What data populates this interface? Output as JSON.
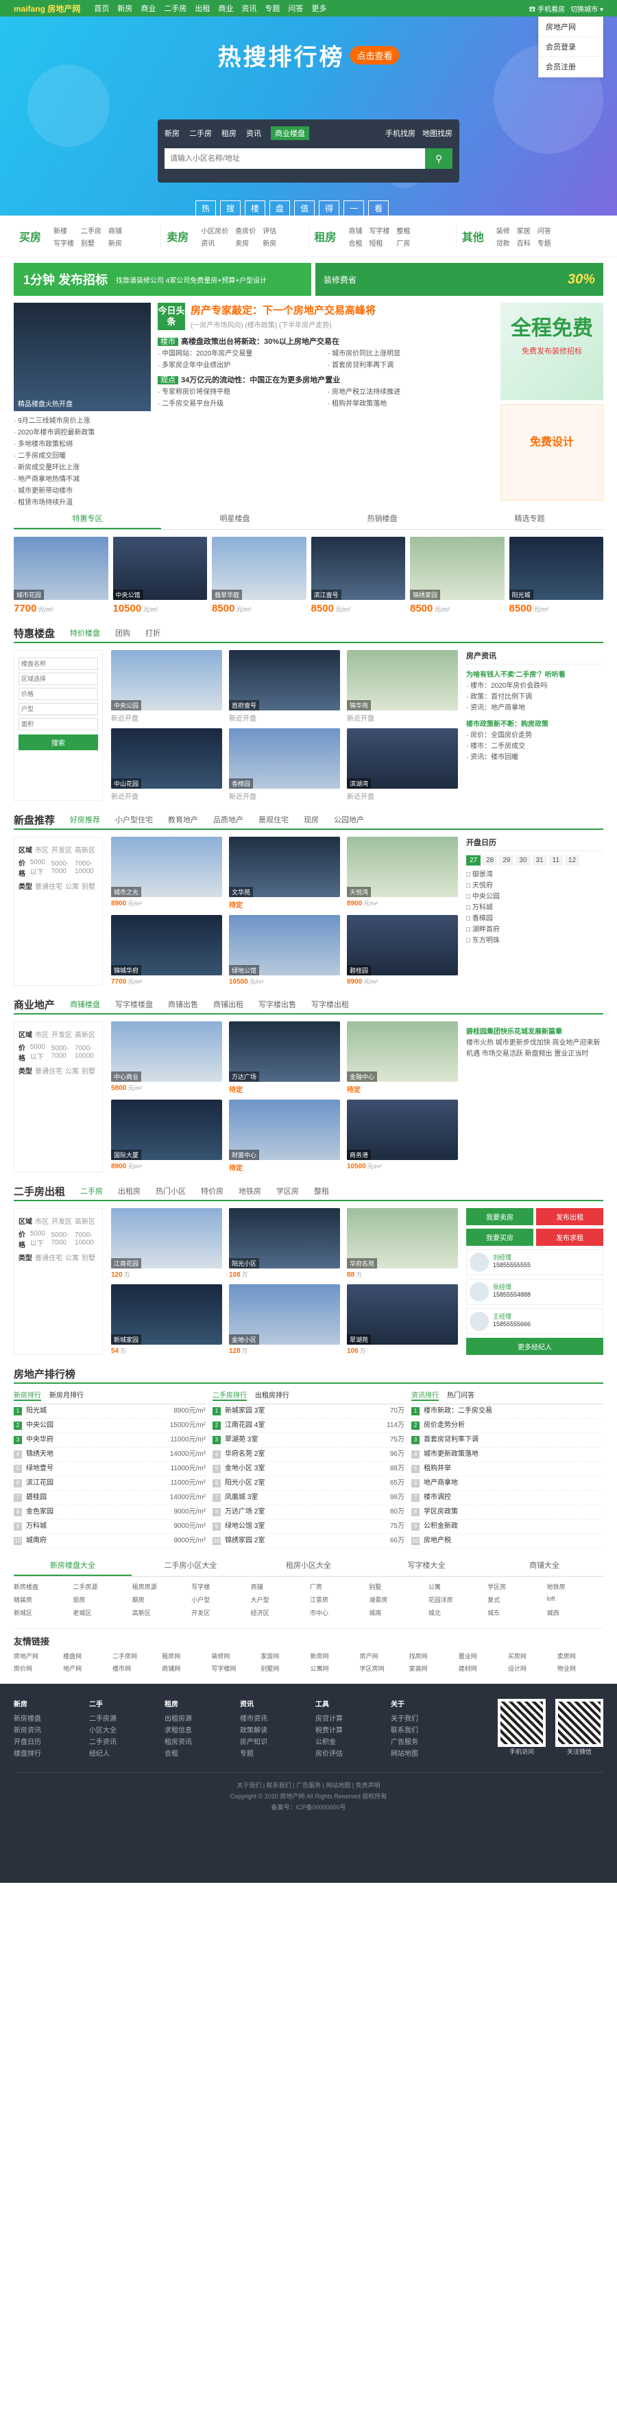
{
  "topbar": {
    "logo": "maifang 房地产网",
    "nav": [
      "首页",
      "新房",
      "商业",
      "二手房",
      "出租",
      "商业",
      "资讯",
      "专题",
      "问答",
      "更多"
    ],
    "phone": "☎ 手机看房",
    "city_switch": "切换城市 ▾",
    "dropdown": [
      "房地产网",
      "会员登录",
      "会员注册"
    ]
  },
  "banner": {
    "title": "热搜排行榜",
    "cta": "点击查看",
    "search_tabs": [
      "新房",
      "二手房",
      "租房",
      "资讯",
      "商业楼盘"
    ],
    "active_tab": "商业楼盘",
    "extra_links": [
      "手机找房",
      "地图找房"
    ],
    "search_placeholder": "请输入小区名称/地址",
    "slogan": [
      "热",
      "搜",
      "楼",
      "盘",
      "值",
      "得",
      "一",
      "看"
    ]
  },
  "quick": [
    {
      "title": "买房",
      "links": [
        "新楼",
        "二手房",
        "商铺",
        "写字楼",
        "别墅",
        "新房"
      ]
    },
    {
      "title": "卖房",
      "links": [
        "小区房价",
        "查房价",
        "评估",
        "资讯",
        "卖房",
        "新房"
      ]
    },
    {
      "title": "租房",
      "links": [
        "商铺",
        "写字楼",
        "整租",
        "合租",
        "短租",
        "厂房"
      ]
    },
    {
      "title": "其他",
      "links": [
        "装修",
        "家居",
        "问答",
        "贷款",
        "百科",
        "专题"
      ]
    }
  ],
  "ad": {
    "left_big": "1分钟 发布招标",
    "left_small": "找靠谱装修公司 4家公司免费量房+预算+户型设计",
    "right_text": "装修费省",
    "right_pct": "30%"
  },
  "headline": {
    "img_caption": "精品楼盘火热开盘",
    "left_list": [
      "9月二三线城市房价上涨",
      "2020年楼市调控最新政策",
      "多地楼市政策松绑",
      "二手房成交回暖",
      "新房成交量环比上涨",
      "地产商拿地热情不减",
      "城市更新带动楼市",
      "租赁市场持续升温"
    ],
    "today_tag": "今日头条",
    "today_title": "房产专家敲定：下一个房地产交易高峰将",
    "today_sub": "(一房产市场风向)  (楼市政策)  (下半年房产走势)",
    "news": [
      {
        "k": "楼市",
        "t": "高楼盘政策出台将新政：30%以上房地产交易在",
        "rows": [
          "中国网站：2020年房产交易量",
          "城市房价同比上涨明显",
          "多家房企年中业绩出炉",
          "首套房贷利率再下调"
        ]
      },
      {
        "k": "观点",
        "t": "34万亿元的流动性：中国正在为更多房地产置业",
        "rows": [
          "专家称房价将保持平稳",
          "房地产税立法持续推进",
          "二手房交易平台升级",
          "租购并举政策落地"
        ]
      }
    ],
    "free_big": "全程免费",
    "free_sub": "免费发布装修招标",
    "design": "免费设计"
  },
  "hot": {
    "tabs": [
      "特惠专区",
      "明星楼盘",
      "热销楼盘",
      "精选专题"
    ],
    "cards": [
      {
        "name": "城市花园",
        "price": "7700",
        "unit": "元/m²"
      },
      {
        "name": "中央公馆",
        "price": "10500",
        "unit": "元/m²"
      },
      {
        "name": "翡翠华庭",
        "price": "8500",
        "unit": "元/m²"
      },
      {
        "name": "滨江壹号",
        "price": "8500",
        "unit": "元/m²"
      },
      {
        "name": "锦绣家园",
        "price": "8500",
        "unit": "元/m²"
      },
      {
        "name": "阳光城",
        "price": "8500",
        "unit": "元/m²"
      }
    ]
  },
  "special": {
    "title": "特惠楼盘",
    "tabs": [
      "特价楼盘",
      "团购",
      "打折"
    ],
    "filter": [
      "楼盘名称",
      "区域选择",
      "价格",
      "户型",
      "面积"
    ],
    "filter_btn": "搜索",
    "items": [
      {
        "name": "中央公园",
        "tag": "新近开盘"
      },
      {
        "name": "首府壹号",
        "tag": "新近开盘"
      },
      {
        "name": "锦华苑",
        "tag": "新近开盘"
      },
      {
        "name": "中山花园",
        "tag": "新近开盘"
      },
      {
        "name": "香樟园",
        "tag": "新近开盘"
      },
      {
        "name": "滨湖湾",
        "tag": "新近开盘"
      }
    ],
    "side_title": "房产资讯",
    "side_hot": [
      "为啥有钱人不卖'二手房'？听听看",
      "楼市政策新不断：购房政策"
    ],
    "side_list": [
      "楼市：2020年房价会跌吗",
      "政策：首付比例下调",
      "资讯：地产商拿地",
      "房价：全国房价走势",
      "楼市：二手房成交",
      "资讯：楼市回暖"
    ]
  },
  "newhouse": {
    "title": "新盘推荐",
    "tabs": [
      "好房推荐",
      "小户型住宅",
      "教育地产",
      "品质地产",
      "景观住宅",
      "现房",
      "公园地产"
    ],
    "filters": [
      [
        "区域",
        "市区",
        "开发区",
        "高新区"
      ],
      [
        "价格",
        "5000以下",
        "5000-7000",
        "7000-10000"
      ],
      [
        "类型",
        "普通住宅",
        "公寓",
        "别墅"
      ]
    ],
    "items": [
      {
        "name": "城市之光",
        "price": "8900",
        "unit": "元/m²"
      },
      {
        "name": "文华苑",
        "price": "待定",
        "unit": ""
      },
      {
        "name": "天悦湾",
        "price": "8900",
        "unit": "元/m²"
      },
      {
        "name": "锦城华府",
        "price": "7700",
        "unit": "元/m²"
      },
      {
        "name": "绿地公馆",
        "price": "10500",
        "unit": "元/m²"
      },
      {
        "name": "碧桂园",
        "price": "8900",
        "unit": "元/m²"
      }
    ],
    "calendar_title": "开盘日历",
    "calendar_days": [
      "27",
      "28",
      "29",
      "30",
      "31",
      "11",
      "12"
    ],
    "calendar_list": [
      "御景湾",
      "天悦府",
      "中央公园",
      "万科城",
      "香樟园",
      "湖畔首府",
      "东方明珠"
    ]
  },
  "commercial": {
    "title": "商业地产",
    "tabs": [
      "商铺楼盘",
      "写字楼楼盘",
      "商铺出售",
      "商铺出租",
      "写字楼出售",
      "写字楼出租"
    ],
    "items": [
      {
        "name": "中心商业",
        "price": "5800",
        "unit": "元/m²"
      },
      {
        "name": "万达广场",
        "price": "待定",
        "unit": ""
      },
      {
        "name": "金融中心",
        "price": "待定",
        "unit": ""
      },
      {
        "name": "国际大厦",
        "price": "8900",
        "unit": "元/m²"
      },
      {
        "name": "财富中心",
        "price": "待定",
        "unit": ""
      },
      {
        "name": "商务港",
        "price": "10500",
        "unit": "元/m²"
      }
    ],
    "side_title": "碧桂园集团快乐花城发展新篇章",
    "side_text": "楼市火热 城市更新步伐加快 商业地产迎来新机遇 市场交易活跃 新盘频出 置业正当时"
  },
  "resale": {
    "title": "二手房出租",
    "tabs": [
      "二手房",
      "出租房",
      "热门小区",
      "特价房",
      "地铁房",
      "学区房",
      "整租"
    ],
    "items": [
      {
        "name": "江南花园",
        "price": "120",
        "unit": "万"
      },
      {
        "name": "阳光小区",
        "price": "108",
        "unit": "万"
      },
      {
        "name": "华府名苑",
        "price": "88",
        "unit": "万"
      },
      {
        "name": "新城家园",
        "price": "54",
        "unit": "万"
      },
      {
        "name": "金地小区",
        "price": "128",
        "unit": "万"
      },
      {
        "name": "翠湖苑",
        "price": "106",
        "unit": "万"
      }
    ],
    "side_btns": [
      "我要卖房",
      "发布出租",
      "我要买房",
      "发布求租"
    ],
    "agents": [
      {
        "name": "刘经理",
        "phone": "15855555555"
      },
      {
        "name": "张经理",
        "phone": "15855554888"
      },
      {
        "name": "王经理",
        "phone": "15855555666"
      }
    ],
    "agent_btn": "更多经纪人"
  },
  "rank": {
    "title": "房地产排行榜",
    "cols": [
      {
        "tabs": [
          "新房排行",
          "新房月排行"
        ],
        "items": [
          [
            "阳光城",
            "8900元/m²"
          ],
          [
            "中央公园",
            "15000元/m²"
          ],
          [
            "中央华府",
            "11000元/m²"
          ],
          [
            "锦绣天地",
            "14000元/m²"
          ],
          [
            "绿地壹号",
            "11000元/m²"
          ],
          [
            "滨江花园",
            "11000元/m²"
          ],
          [
            "碧桂园",
            "14000元/m²"
          ],
          [
            "金色家园",
            "9000元/m²"
          ],
          [
            "万科城",
            "9000元/m²"
          ],
          [
            "城南府",
            "9000元/m²"
          ]
        ]
      },
      {
        "tabs": [
          "二手房排行",
          "出租房排行"
        ],
        "items": [
          [
            "新城家园 3室",
            "70万"
          ],
          [
            "江南花园 4室",
            "114万"
          ],
          [
            "翠湖苑 3室",
            "75万"
          ],
          [
            "华府名苑 2室",
            "96万"
          ],
          [
            "金地小区 3室",
            "88万"
          ],
          [
            "阳光小区 2室",
            "65万"
          ],
          [
            "凤凰城 3室",
            "98万"
          ],
          [
            "万达广场 2室",
            "80万"
          ],
          [
            "绿地公馆 3室",
            "75万"
          ],
          [
            "锦绣家园 2室",
            "66万"
          ]
        ]
      },
      {
        "tabs": [
          "资讯排行",
          "热门问答"
        ],
        "items": [
          [
            "楼市新政：二手房交易",
            "1"
          ],
          [
            "房价走势分析",
            "2"
          ],
          [
            "首套房贷利率下调",
            "3"
          ],
          [
            "城市更新政策落地",
            "4"
          ],
          [
            "租购并举",
            "5"
          ],
          [
            "地产商拿地",
            "6"
          ],
          [
            "楼市调控",
            "7"
          ],
          [
            "学区房政策",
            "8"
          ],
          [
            "公积金新政",
            "9"
          ],
          [
            "房地产税",
            "10"
          ]
        ]
      }
    ],
    "tag_tabs": [
      "新房楼盘大全",
      "二手房小区大全",
      "租房小区大全",
      "写字楼大全",
      "商铺大全"
    ],
    "tags": [
      "新房楼盘",
      "二手房源",
      "租房房源",
      "写字楼",
      "商铺",
      "厂房",
      "别墅",
      "公寓",
      "学区房",
      "地铁房",
      "精装房",
      "现房",
      "期房",
      "小户型",
      "大户型",
      "江景房",
      "湖景房",
      "花园洋房",
      "复式",
      "loft",
      "新城区",
      "老城区",
      "高新区",
      "开发区",
      "经济区",
      "市中心",
      "城南",
      "城北",
      "城东",
      "城西"
    ]
  },
  "friend": {
    "title": "友情链接",
    "links": [
      "房地产网",
      "楼盘网",
      "二手房网",
      "租房网",
      "装修网",
      "家居网",
      "新房网",
      "房产网",
      "找房网",
      "置业网",
      "买房网",
      "卖房网",
      "房价网",
      "地产网",
      "楼市网",
      "商铺网",
      "写字楼网",
      "别墅网",
      "公寓网",
      "学区房网",
      "家装网",
      "建材网",
      "设计网",
      "物业网"
    ]
  },
  "footer": {
    "cols": [
      {
        "title": "新房",
        "links": [
          "新房楼盘",
          "新房资讯",
          "开盘日历",
          "楼盘排行"
        ]
      },
      {
        "title": "二手",
        "links": [
          "二手房源",
          "小区大全",
          "二手资讯",
          "经纪人"
        ]
      },
      {
        "title": "租房",
        "links": [
          "出租房源",
          "求租信息",
          "租房资讯",
          "合租"
        ]
      },
      {
        "title": "资讯",
        "links": [
          "楼市资讯",
          "政策解读",
          "房产知识",
          "专题"
        ]
      },
      {
        "title": "工具",
        "links": [
          "房贷计算",
          "税费计算",
          "公积金",
          "房价评估"
        ]
      },
      {
        "title": "关于",
        "links": [
          "关于我们",
          "联系我们",
          "广告服务",
          "网站地图"
        ]
      }
    ],
    "qr": [
      "手机访问",
      "关注微信"
    ],
    "copy": [
      "关于我们 | 联系我们 | 广告服务 | 网站地图 | 免责声明",
      "Copyright © 2020 房地产网 All Rights Reserved 版权所有",
      "备案号：ICP备00000000号"
    ]
  }
}
